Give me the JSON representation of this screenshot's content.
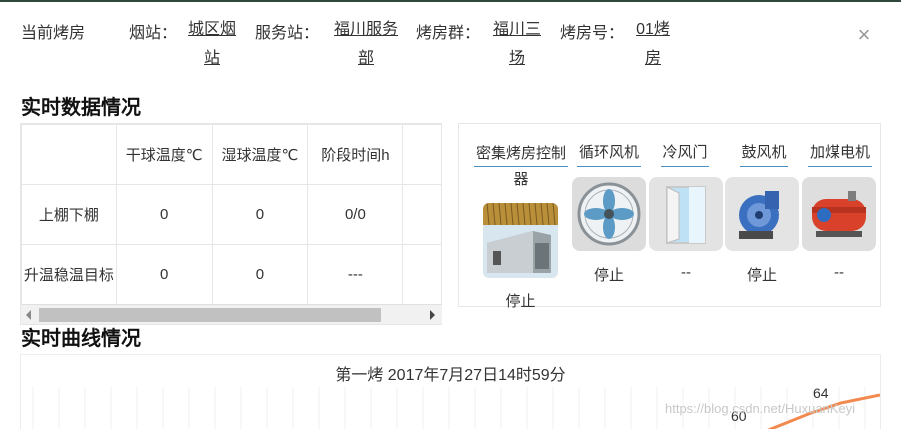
{
  "header": {
    "title": "当前烤房",
    "fields": [
      {
        "label": "烟站：",
        "value_lines": [
          "城区烟",
          "站"
        ]
      },
      {
        "label": "服务站：",
        "value_lines": [
          "福川服务",
          "部"
        ]
      },
      {
        "label": "烤房群：",
        "value_lines": [
          "福川三",
          "场"
        ]
      },
      {
        "label": "烤房号：",
        "value_lines": [
          "01烤",
          "房"
        ]
      }
    ],
    "close_symbol": "×"
  },
  "realtime_data": {
    "title": "实时数据情况",
    "columns": [
      "",
      "干球温度℃",
      "湿球温度℃",
      "阶段时间h"
    ],
    "rows": [
      {
        "name": "上棚下棚",
        "values": [
          "0",
          "0",
          "0/0"
        ]
      },
      {
        "name": "升温稳温目标",
        "values": [
          "0",
          "0",
          "---"
        ]
      }
    ]
  },
  "controls": {
    "devices": [
      {
        "label": "密集烤房控制器",
        "status": "停止",
        "icon": "curing-barn-icon"
      },
      {
        "label": "循环风机",
        "status": "停止",
        "icon": "fan-icon"
      },
      {
        "label": "冷风门",
        "status": "--",
        "icon": "door-icon"
      },
      {
        "label": "鼓风机",
        "status": "停止",
        "icon": "blower-icon"
      },
      {
        "label": "加煤电机",
        "status": "--",
        "icon": "coal-motor-icon"
      }
    ]
  },
  "curve": {
    "title": "实时曲线情况",
    "chart_title": "第一烤 2017年7月27日14时59分",
    "point_labels": [
      "60",
      "64"
    ],
    "line_color": "#f2894e"
  },
  "watermark": "https://blog.csdn.net/HuxuanKeyi"
}
